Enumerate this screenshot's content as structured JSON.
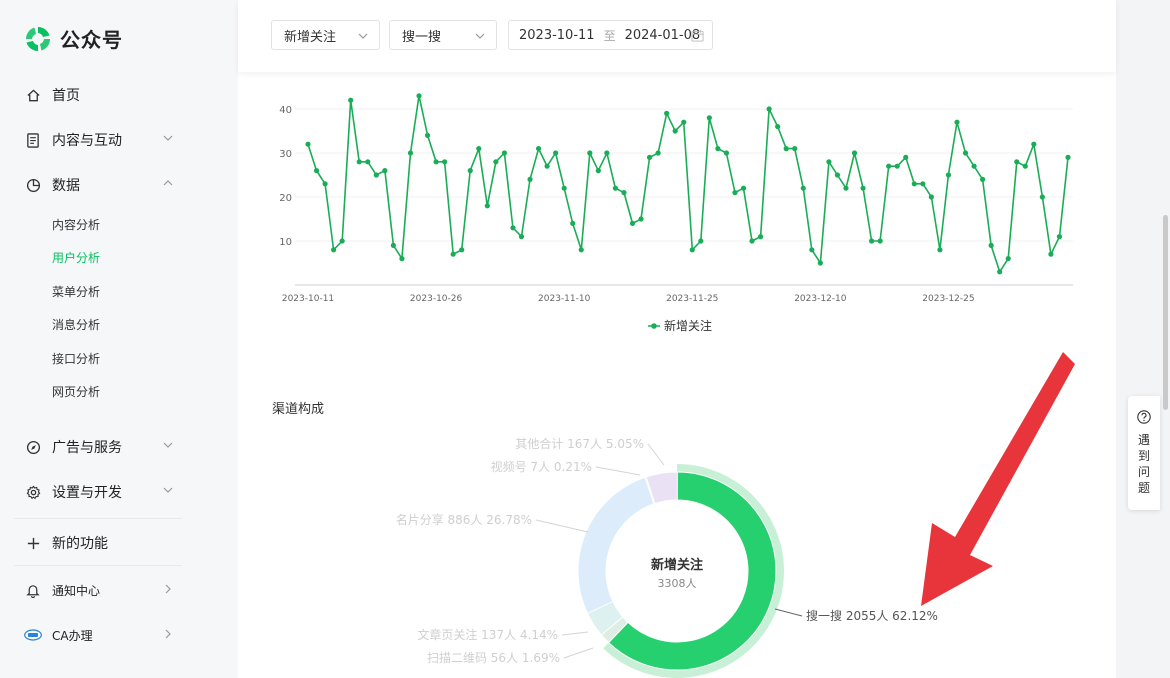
{
  "brand": {
    "name": "公众号",
    "color": "#07c160"
  },
  "sidebar": {
    "items": [
      {
        "label": "首页",
        "icon": "home-icon"
      },
      {
        "label": "内容与互动",
        "icon": "document-icon"
      },
      {
        "label": "数据",
        "icon": "pie-chart-icon"
      },
      {
        "label": "广告与服务",
        "icon": "compass-icon"
      },
      {
        "label": "设置与开发",
        "icon": "gear-icon"
      },
      {
        "label": "新的功能",
        "icon": "plus-icon"
      },
      {
        "label": "通知中心",
        "icon": "bell-icon"
      },
      {
        "label": "CA办理",
        "icon": "ca-logo-icon"
      }
    ],
    "data_sub": [
      "内容分析",
      "用户分析",
      "菜单分析",
      "消息分析",
      "接口分析",
      "网页分析"
    ],
    "active_sub": "用户分析"
  },
  "filters": {
    "metric": "新增关注",
    "source": "搜一搜",
    "date_start": "2023-10-11",
    "date_sep": "至",
    "date_end": "2024-01-08"
  },
  "section_title": "渠道构成",
  "help": {
    "text": "遇到问题"
  },
  "chart_data": [
    {
      "type": "line",
      "x_labels": [
        "2023-10-11",
        "2023-10-26",
        "2023-11-10",
        "2023-11-25",
        "2023-12-10",
        "2023-12-25"
      ],
      "yticks": [
        10,
        20,
        30,
        40
      ],
      "ylim": [
        0,
        44
      ],
      "grid": true,
      "legend": "bottom-center",
      "color": "#1aad57",
      "series": [
        {
          "name": "新增关注",
          "values": [
            32,
            26,
            23,
            8,
            10,
            42,
            28,
            28,
            25,
            26,
            9,
            6,
            30,
            43,
            34,
            28,
            28,
            7,
            8,
            26,
            31,
            18,
            28,
            30,
            13,
            11,
            24,
            31,
            27,
            30,
            22,
            14,
            8,
            30,
            26,
            30,
            22,
            21,
            14,
            15,
            29,
            30,
            39,
            35,
            37,
            8,
            10,
            38,
            31,
            30,
            21,
            22,
            10,
            11,
            40,
            36,
            31,
            31,
            22,
            8,
            5,
            28,
            25,
            22,
            30,
            22,
            10,
            10,
            27,
            27,
            29,
            23,
            23,
            20,
            8,
            25,
            37,
            30,
            27,
            24,
            9,
            3,
            6,
            28,
            27,
            32,
            20,
            7,
            11,
            29
          ]
        }
      ]
    },
    {
      "type": "pie",
      "center_title": "新增关注",
      "center_subtitle": "3308人",
      "slices": [
        {
          "label": "搜一搜 2055人 62.12%",
          "value": 62.12,
          "color": "#27d06e",
          "highlight": true
        },
        {
          "label": "扫描二维码 56人 1.69%",
          "value": 1.69,
          "color": "#dfeee5"
        },
        {
          "label": "文章页关注 137人 4.14%",
          "value": 4.14,
          "color": "#dcf1f0"
        },
        {
          "label": "名片分享 886人 26.78%",
          "value": 26.78,
          "color": "#ddecfb"
        },
        {
          "label": "视频号 7人 0.21%",
          "value": 0.21,
          "color": "#e8e3f4"
        },
        {
          "label": "其他合计 167人 5.05%",
          "value": 5.05,
          "color": "#ebe1f5"
        }
      ]
    }
  ]
}
